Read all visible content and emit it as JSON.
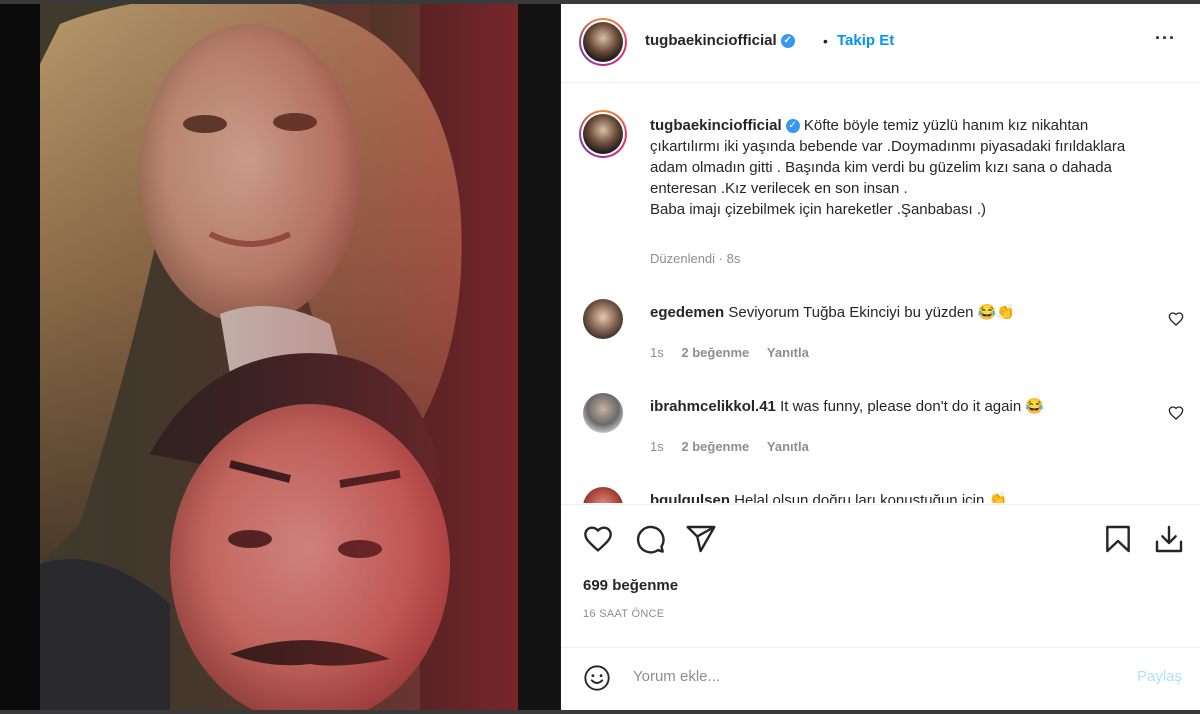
{
  "header": {
    "username": "tugbaekinciofficial",
    "separator": "•",
    "follow_label": "Takip Et",
    "more_icon": "more-options-icon"
  },
  "caption": {
    "username": "tugbaekinciofficial",
    "text": "Köfte böyle temiz yüzlü hanım kız nikahtan çıkartılırmı iki yaşında bebende var .Doymadınmı piyasadaki fırıldaklara adam olmadın gitti . Başında kim verdi bu güzelim kızı sana o dahada enteresan .Kız verilecek en son insan .",
    "text2": "Baba imajı çizebilmek için hareketler .Şanbabası .)",
    "edited": "Düzenlendi",
    "dot": "·",
    "age": "8s"
  },
  "comments": [
    {
      "username": "egedemen",
      "text": "Seviyorum Tuğba Ekinciyi bu yüzden 😂👏",
      "age": "1s",
      "likes": "2 beğenme",
      "reply": "Yanıtla"
    },
    {
      "username": "ibrahmcelikkol.41",
      "text": "It was funny, please don't do it again 😂",
      "age": "1s",
      "likes": "2 beğenme",
      "reply": "Yanıtla"
    },
    {
      "username": "bgulgulsen",
      "text": "Helal olsun doğru ları konuştuğun için 👏"
    }
  ],
  "actions": {
    "like_icon": "heart-icon",
    "comment_icon": "comment-icon",
    "share_icon": "share-icon",
    "save_icon": "bookmark-icon",
    "download_icon": "download-icon",
    "likes_count": "699 beğenme",
    "time_ago": "16 SAAT ÖNCE"
  },
  "add_comment": {
    "placeholder": "Yorum ekle...",
    "post_label": "Paylaş",
    "emoji_icon": "emoji-icon"
  },
  "colors": {
    "accent": "#0095f6",
    "verified": "#3897f0",
    "muted": "#8e8e8e"
  }
}
